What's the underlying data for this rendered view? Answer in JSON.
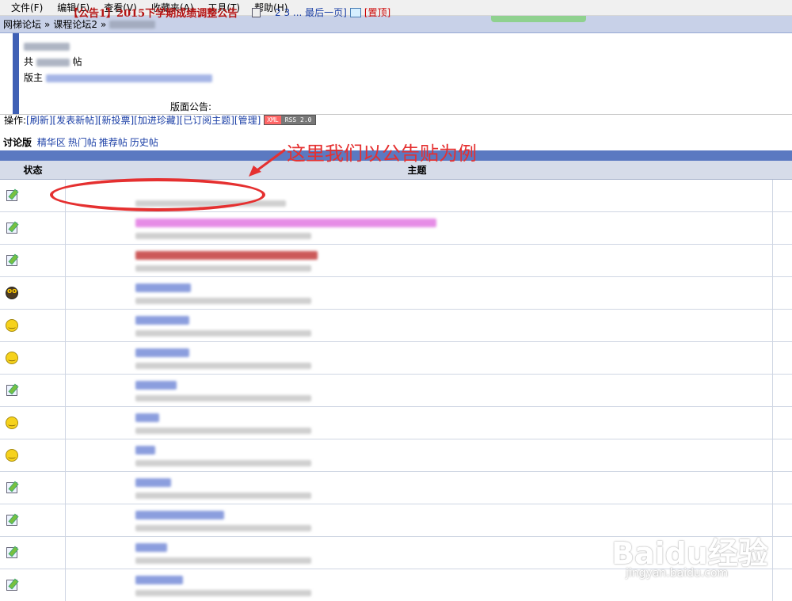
{
  "menu": [
    "文件(F)",
    "编辑(E)",
    "查看(V)",
    "收藏夹(A)",
    "工具(T)",
    "帮助(H)"
  ],
  "breadcrumb": {
    "root": "网梯论坛",
    "sep": "»",
    "forum": "课程论坛2",
    "sep2": "»"
  },
  "forum_info": {
    "count_prefix": "共",
    "count_suffix": "帖",
    "moderator_label": "版主",
    "notice_label": "版面公告:"
  },
  "ops": {
    "label": "操作:",
    "links": [
      "[刷新]",
      "[发表新帖]",
      "[新投票]",
      "[加进珍藏]",
      "[已订阅主题]",
      "[管理]"
    ],
    "rss_left": "XML",
    "rss_right": "RSS 2.0"
  },
  "tabs": {
    "current": "讨论版",
    "links": [
      "精华区",
      "热门帖",
      "推荐帖",
      "历史帖"
    ]
  },
  "table_header": {
    "status": "状态",
    "topic": "主题"
  },
  "first_topic": {
    "title": "【公告1】2015下学期成绩调整公告",
    "pages": "2 3 ... 最后一页]",
    "sticky": "[置顶]"
  },
  "row_icons": [
    "edit-icon",
    "edit-icon",
    "edit-icon",
    "dark-smiley-icon",
    "smiley-icon",
    "smiley-icon",
    "edit-icon",
    "smiley-icon",
    "smiley-icon",
    "edit-icon",
    "edit-icon",
    "edit-icon",
    "edit-icon"
  ],
  "annotation": {
    "text": "这里我们以公告贴为例",
    "color": "#e53030"
  },
  "watermark": {
    "brand": "Baidu经验",
    "url": "jingyan.baidu.com"
  },
  "colors": {
    "header_bar": "#5b79c1",
    "breadcrumb_bg": "#c8d1e8",
    "sticky_title": "#b51414",
    "link": "#1b3fa6"
  }
}
